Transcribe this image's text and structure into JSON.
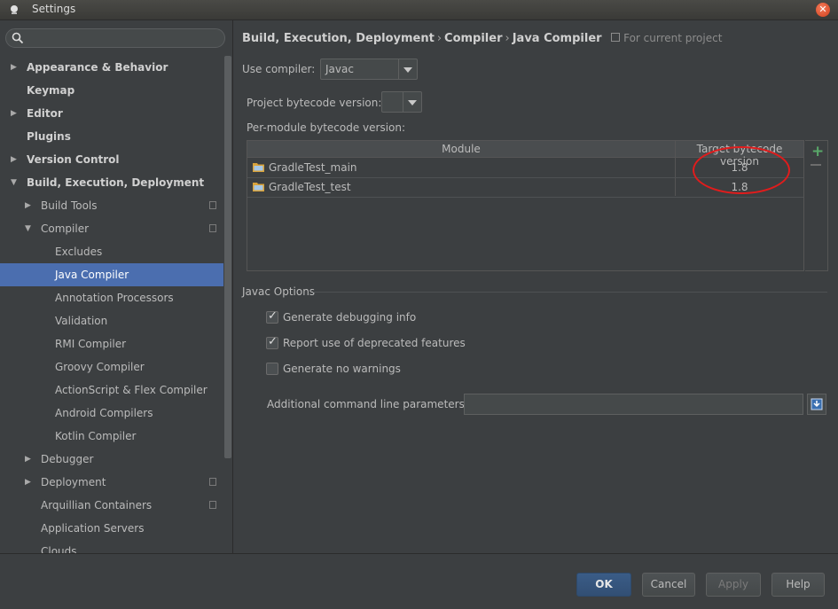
{
  "window": {
    "title": "Settings"
  },
  "sidebar": {
    "search_placeholder": "",
    "items": [
      {
        "label": "Appearance & Behavior",
        "level": 0,
        "arrow": "right",
        "bold": true,
        "project": false
      },
      {
        "label": "Keymap",
        "level": 0,
        "arrow": "none",
        "bold": true,
        "project": false
      },
      {
        "label": "Editor",
        "level": 0,
        "arrow": "right",
        "bold": true,
        "project": false
      },
      {
        "label": "Plugins",
        "level": 0,
        "arrow": "none",
        "bold": true,
        "project": false
      },
      {
        "label": "Version Control",
        "level": 0,
        "arrow": "right",
        "bold": true,
        "project": false
      },
      {
        "label": "Build, Execution, Deployment",
        "level": 0,
        "arrow": "down",
        "bold": true,
        "project": false
      },
      {
        "label": "Build Tools",
        "level": 1,
        "arrow": "right",
        "bold": false,
        "project": true
      },
      {
        "label": "Compiler",
        "level": 1,
        "arrow": "down",
        "bold": false,
        "project": true
      },
      {
        "label": "Excludes",
        "level": 2,
        "arrow": "none",
        "bold": false,
        "project": false
      },
      {
        "label": "Java Compiler",
        "level": 2,
        "arrow": "none",
        "bold": false,
        "project": false,
        "selected": true
      },
      {
        "label": "Annotation Processors",
        "level": 2,
        "arrow": "none",
        "bold": false,
        "project": false
      },
      {
        "label": "Validation",
        "level": 2,
        "arrow": "none",
        "bold": false,
        "project": false
      },
      {
        "label": "RMI Compiler",
        "level": 2,
        "arrow": "none",
        "bold": false,
        "project": false
      },
      {
        "label": "Groovy Compiler",
        "level": 2,
        "arrow": "none",
        "bold": false,
        "project": false
      },
      {
        "label": "ActionScript & Flex Compiler",
        "level": 2,
        "arrow": "none",
        "bold": false,
        "project": false
      },
      {
        "label": "Android Compilers",
        "level": 2,
        "arrow": "none",
        "bold": false,
        "project": false
      },
      {
        "label": "Kotlin Compiler",
        "level": 2,
        "arrow": "none",
        "bold": false,
        "project": false
      },
      {
        "label": "Debugger",
        "level": 1,
        "arrow": "right",
        "bold": false,
        "project": false
      },
      {
        "label": "Deployment",
        "level": 1,
        "arrow": "right",
        "bold": false,
        "project": true
      },
      {
        "label": "Arquillian Containers",
        "level": 1,
        "arrow": "none",
        "bold": false,
        "project": true
      },
      {
        "label": "Application Servers",
        "level": 1,
        "arrow": "none",
        "bold": false,
        "project": false
      },
      {
        "label": "Clouds",
        "level": 1,
        "arrow": "none",
        "bold": false,
        "project": false
      }
    ]
  },
  "breadcrumb": {
    "parts": [
      "Build, Execution, Deployment",
      "Compiler",
      "Java Compiler"
    ],
    "separator": "›",
    "note": "For current project"
  },
  "compiler": {
    "label": "Use compiler:",
    "value": "Javac"
  },
  "bytecode": {
    "label": "Project bytecode version:",
    "value": ""
  },
  "per_module": {
    "label": "Per-module bytecode version:",
    "columns": [
      "Module",
      "Target bytecode version"
    ],
    "rows": [
      {
        "module": "GradleTest_main",
        "version": "1.8"
      },
      {
        "module": "GradleTest_test",
        "version": "1.8"
      }
    ],
    "add_symbol": "+"
  },
  "javac_options": {
    "title": "Javac Options",
    "options": [
      {
        "label": "Generate debugging info",
        "checked": true
      },
      {
        "label": "Report use of deprecated features",
        "checked": true
      },
      {
        "label": "Generate no warnings",
        "checked": false
      }
    ],
    "params_label": "Additional command line parameters:",
    "params_value": ""
  },
  "footer": {
    "ok": "OK",
    "cancel": "Cancel",
    "apply": "Apply",
    "help": "Help"
  },
  "colors": {
    "accent": "#4b6eaf",
    "annotation": "#e01c1c",
    "add": "#59a869"
  }
}
